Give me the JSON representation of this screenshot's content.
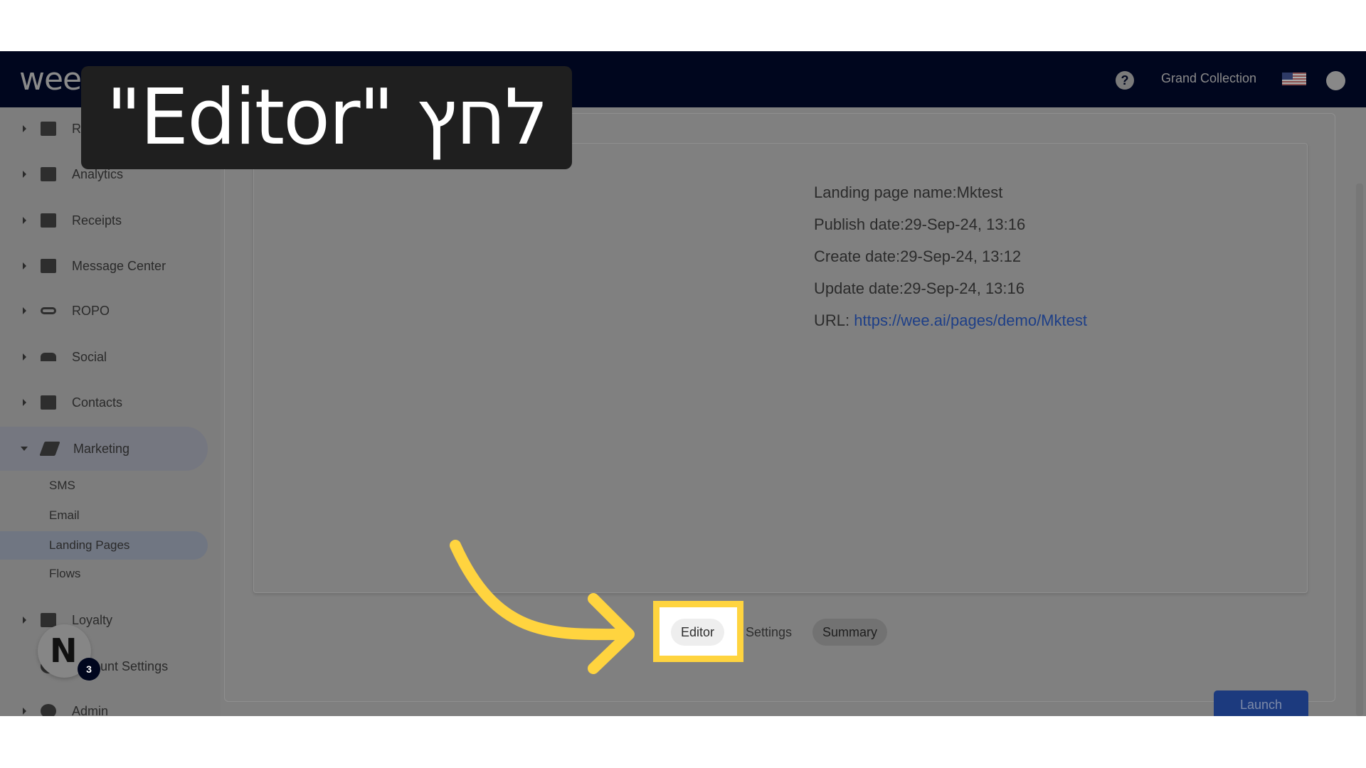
{
  "header": {
    "logo": "weezmo",
    "help": "?",
    "org": "Grand Collection"
  },
  "sidebar": {
    "items": [
      {
        "label": "Reports",
        "icon": "dashboard-icon"
      },
      {
        "label": "Analytics",
        "icon": "bar-chart-icon"
      },
      {
        "label": "Receipts",
        "icon": "receipt-icon"
      },
      {
        "label": "Message Center",
        "icon": "chat-icon"
      },
      {
        "label": "ROPO",
        "icon": "infinity-icon"
      },
      {
        "label": "Social",
        "icon": "people-icon"
      },
      {
        "label": "Contacts",
        "icon": "contacts-icon"
      },
      {
        "label": "Marketing",
        "icon": "megaphone-icon"
      }
    ],
    "marketing_sub": [
      "SMS",
      "Email",
      "Landing Pages",
      "Flows"
    ],
    "bottom_items": [
      {
        "label": "Loyalty",
        "icon": "tag-heart-icon"
      },
      {
        "label": "Account Settings",
        "icon": "gear-icon"
      },
      {
        "label": "Admin",
        "icon": "admin-gear-icon"
      }
    ]
  },
  "details": {
    "name": "Landing page name:Mktest",
    "publish": "Publish date:29-Sep-24, 13:16",
    "create": "Create date:29-Sep-24, 13:12",
    "update": "Update date:29-Sep-24, 13:16",
    "url_label": "URL: ",
    "url": "https://wee.ai/pages/demo/Mktest"
  },
  "tabs": {
    "editor": "Editor",
    "settings": "Settings",
    "summary": "Summary"
  },
  "launch": "Launch",
  "caption": "\"Editor\" לחץ",
  "notification": {
    "avatar": "N",
    "count": "3"
  },
  "colors": {
    "header": "#00061e",
    "highlight": "#ffd43f",
    "launch": "#1c3a7e",
    "link": "#1e3f87"
  }
}
